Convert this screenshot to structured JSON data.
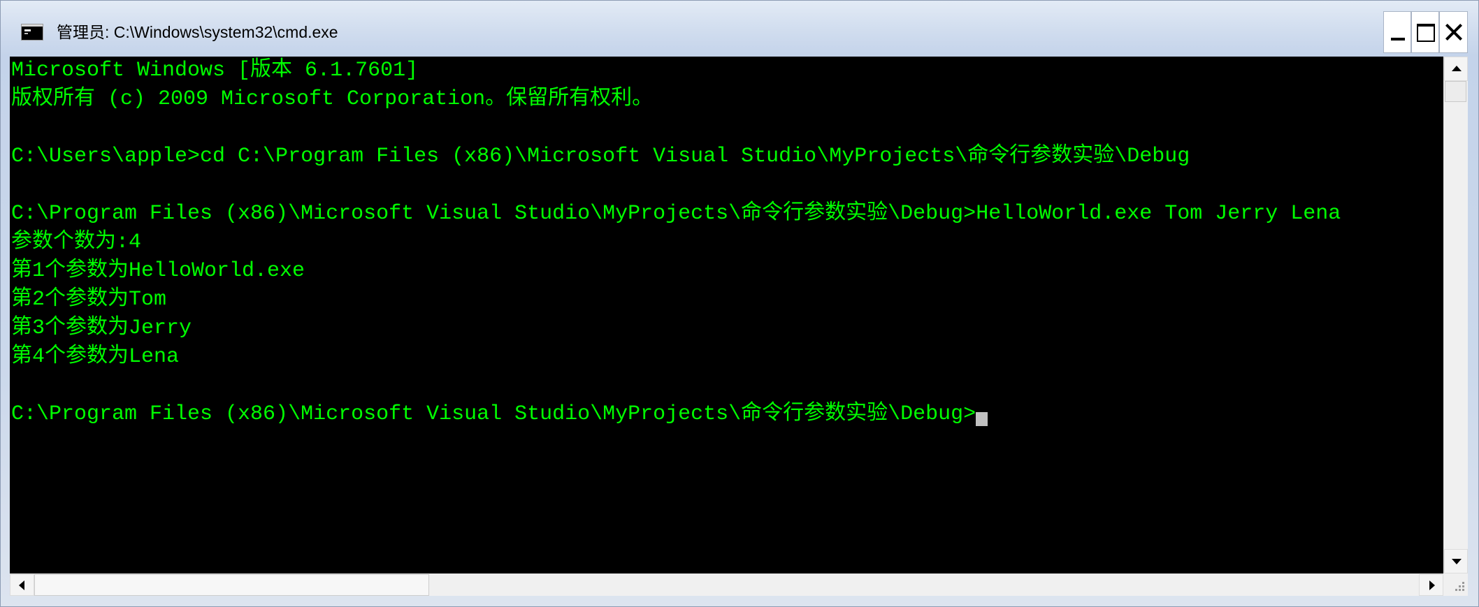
{
  "window": {
    "title": "管理员: C:\\Windows\\system32\\cmd.exe",
    "icon": "cmd-app-icon"
  },
  "title_buttons": {
    "minimize_icon": "minimize-icon",
    "maximize_icon": "maximize-icon",
    "close_icon": "close-icon"
  },
  "console": {
    "text_color": "#00ff00",
    "background_color": "#000000",
    "cursor_color": "#c0c0c0",
    "lines": [
      "Microsoft Windows [版本 6.1.7601]",
      "版权所有 (c) 2009 Microsoft Corporation。保留所有权利。",
      "",
      "C:\\Users\\apple>cd C:\\Program Files (x86)\\Microsoft Visual Studio\\MyProjects\\命令行参数实验\\Debug",
      "",
      "C:\\Program Files (x86)\\Microsoft Visual Studio\\MyProjects\\命令行参数实验\\Debug>HelloWorld.exe Tom Jerry Lena",
      "参数个数为:4",
      "第1个参数为HelloWorld.exe",
      "第2个参数为Tom",
      "第3个参数为Jerry",
      "第4个参数为Lena",
      "",
      "C:\\Program Files (x86)\\Microsoft Visual Studio\\MyProjects\\命令行参数实验\\Debug>"
    ]
  },
  "scrollbars": {
    "vertical_position": 0,
    "horizontal_position": 0,
    "icons": [
      "scroll-up-arrow-icon",
      "scroll-down-arrow-icon",
      "scroll-left-arrow-icon",
      "scroll-right-arrow-icon",
      "resize-grip-icon"
    ]
  }
}
